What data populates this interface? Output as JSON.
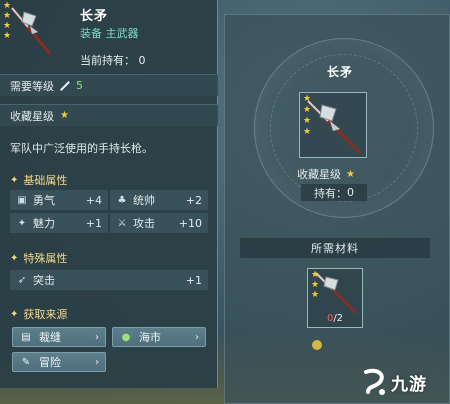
{
  "item": {
    "name": "长矛",
    "type": "装备 主武器",
    "owned_label": "当前持有：",
    "owned_value": "0",
    "stars": 4
  },
  "level": {
    "label": "需要等级",
    "value": "5"
  },
  "collection": {
    "label": "收藏星级"
  },
  "description": "军队中广泛使用的手持长枪。",
  "basic_attrs": {
    "title": "基础属性",
    "items": [
      {
        "icon": "courage-icon",
        "glyph": "▣",
        "name": "勇气",
        "value": "+4"
      },
      {
        "icon": "command-icon",
        "glyph": "♣",
        "name": "统帅",
        "value": "+2"
      },
      {
        "icon": "charm-icon",
        "glyph": "✦",
        "name": "魅力",
        "value": "+1"
      },
      {
        "icon": "attack-icon",
        "glyph": "⚔",
        "name": "攻击",
        "value": "+10"
      }
    ]
  },
  "special_attrs": {
    "title": "特殊属性",
    "items": [
      {
        "icon": "charge-icon",
        "glyph": "➶",
        "name": "突击",
        "value": "+1"
      }
    ]
  },
  "sources": {
    "title": "获取来源",
    "items": [
      {
        "icon": "tailor-icon",
        "glyph": "▤",
        "name": "裁缝",
        "arrow": "›"
      },
      {
        "icon": "market-icon",
        "glyph": "●",
        "name": "海市",
        "arrow": "›"
      },
      {
        "icon": "adventure-icon",
        "glyph": "✎",
        "name": "冒险",
        "arrow": "›"
      }
    ]
  },
  "detail": {
    "title": "长矛",
    "rank_label": "收藏星级",
    "owned_label": "持有：",
    "owned_value": "0"
  },
  "materials": {
    "title": "所需材料",
    "have": "0",
    "need": "/2"
  },
  "watermark": "九游",
  "colors": {
    "star": "#f2cc3a",
    "level_value": "#8be36b",
    "subtitle": "#7ddcc6",
    "section_title": "#f3d98a",
    "insufficient": "#ff5b5b"
  }
}
